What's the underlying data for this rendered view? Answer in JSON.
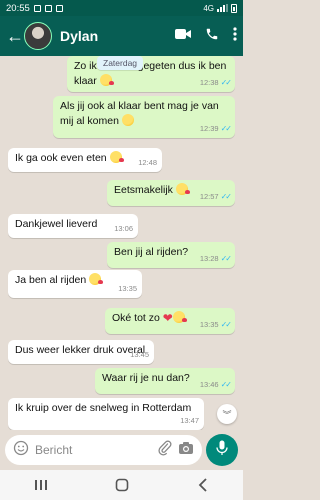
{
  "status_bar": {
    "time": "20:55",
    "network": "4G",
    "signal_level": 0.75,
    "battery_level": 0.5
  },
  "header": {
    "contact_name": "Dylan",
    "back_icon": "arrow-left-icon",
    "actions": [
      "video-call-icon",
      "phone-icon",
      "more-vert-icon"
    ]
  },
  "chat": {
    "date_chip": "Zaterdag",
    "messages": [
      {
        "dir": "out",
        "text": "Zo ik heb net gegeten dus ik ben klaar",
        "emoji": "kissing-face",
        "time": "12:38",
        "read": true
      },
      {
        "dir": "out",
        "text": "Als jij ook al klaar bent mag je van mij al komen",
        "emoji": "relieved-face",
        "time": "12:39",
        "read": true
      },
      {
        "dir": "in",
        "text": "Ik ga ook even eten",
        "emoji": "kissing-face",
        "time": "12:48"
      },
      {
        "dir": "out",
        "text": "Eetsmakelijk",
        "emoji": "kissing-face",
        "time": "12:57",
        "read": true
      },
      {
        "dir": "in",
        "text": "Dankjewel lieverd",
        "time": "13:06"
      },
      {
        "dir": "out",
        "text": "Ben jij al rijden?",
        "time": "13:28",
        "read": true
      },
      {
        "dir": "in",
        "text": "Ja ben al rijden",
        "emoji": "kissing-face",
        "time": "13:35"
      },
      {
        "dir": "out",
        "text": "Oké tot zo",
        "emoji": "heart+kissing-face",
        "time": "13:35",
        "read": true
      },
      {
        "dir": "in",
        "text": "Dus weer lekker druk overal",
        "time": "13:45"
      },
      {
        "dir": "out",
        "text": "Waar rij je nu dan?",
        "time": "13:46",
        "read": true
      },
      {
        "dir": "in",
        "text": "Ik kruip over de snelweg in Rotterdam",
        "time": "13:47"
      }
    ]
  },
  "input": {
    "placeholder": "Bericht",
    "icons": [
      "emoji-icon",
      "attach-icon",
      "camera-icon",
      "mic-icon"
    ]
  },
  "colors": {
    "header": "#075e54",
    "status_bar": "#05594d",
    "incoming": "#ffffff",
    "outgoing": "#dcf8c6",
    "background": "#e5ddd5",
    "read_ticks": "#34b7f1",
    "mic_button": "#00897b"
  }
}
